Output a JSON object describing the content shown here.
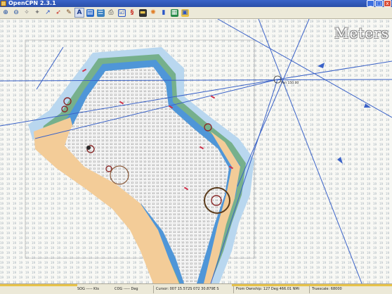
{
  "window": {
    "title": "OpenCPN 2.3.1",
    "controls": [
      "_",
      "□",
      "x"
    ]
  },
  "toolbar": {
    "icons": [
      {
        "name": "zoom-in-icon",
        "glyph": "🔍+"
      },
      {
        "name": "zoom-out-icon",
        "glyph": "🔍-"
      },
      {
        "name": "scale-in-icon",
        "glyph": "◐"
      },
      {
        "name": "scale-out-icon",
        "glyph": "◑"
      },
      {
        "name": "route-icon",
        "glyph": "⤴"
      },
      {
        "name": "auto-follow-icon",
        "glyph": "➶"
      },
      {
        "name": "measure-icon",
        "glyph": "✎"
      },
      {
        "name": "text-icon",
        "glyph": "A"
      },
      {
        "name": "route-manager-icon",
        "glyph": "▤"
      },
      {
        "name": "track-icon",
        "glyph": "☰"
      },
      {
        "name": "print-icon",
        "glyph": "⎙"
      },
      {
        "name": "settings-icon",
        "glyph": "☑"
      },
      {
        "name": "current-icon",
        "glyph": "§"
      },
      {
        "name": "tide-icon",
        "glyph": "▬"
      },
      {
        "name": "ais-icon",
        "glyph": "✺"
      },
      {
        "name": "help-icon",
        "glyph": "?"
      },
      {
        "name": "chart-bar-icon",
        "glyph": "▦"
      },
      {
        "name": "about-icon",
        "glyph": "▣"
      }
    ]
  },
  "chart": {
    "units_label": "Meters",
    "waypoint_label": "Pan 150.00"
  },
  "status": {
    "sog": "SOG ----- Kts",
    "cog": "COG ----- Deg",
    "cursor": "Cursor: 007 15.572S 072 30.879E S",
    "from_ownship": "From Ownship: 127 Deg  466.01 NMi",
    "scale": "Truescale: 68000"
  },
  "colors": {
    "sea_deep": "#f7f7f3",
    "sea_shallow": "#9dc6ea",
    "sea_very_shallow": "#5aa0de",
    "land": "#f2c996",
    "reef": "#7fb38a"
  }
}
